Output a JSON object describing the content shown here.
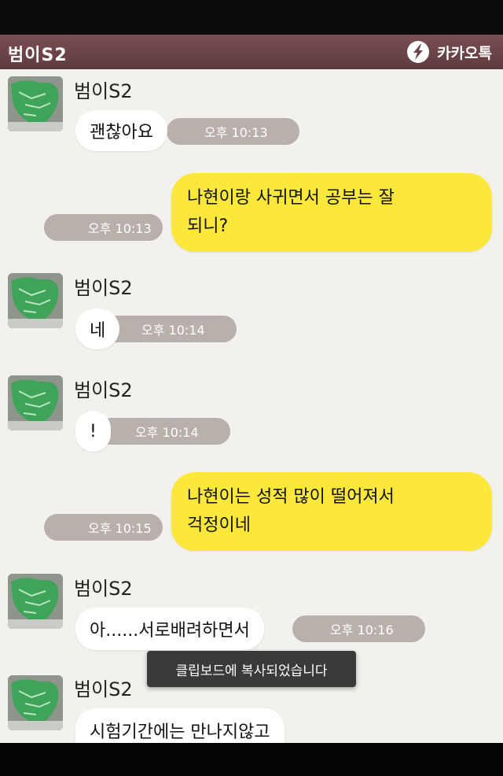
{
  "header": {
    "chat_name": "범이S2",
    "brand": "카카오톡"
  },
  "messages": [
    {
      "sender": "범이S2",
      "text": "괜찮아요",
      "time": "오후 10:13"
    },
    {
      "text": "나현이랑 사귀면서 공부는 잘",
      "text2": "되니?",
      "time": "오후 10:13"
    },
    {
      "sender": "범이S2",
      "text": "네",
      "time": "오후 10:14"
    },
    {
      "sender": "범이S2",
      "text": "!",
      "time": "오후 10:14"
    },
    {
      "text": "나현이는 성적 많이 떨어져서",
      "text2": "걱정이네",
      "time": "오후 10:15"
    },
    {
      "sender": "범이S2",
      "text": "아......서로배려하면서",
      "time": "오후 10:16"
    },
    {
      "sender": "범이S2",
      "text": "시험기간에는 만나지않고"
    }
  ],
  "toast": "클립보드에 복사되었습니다",
  "colors": {
    "title_bar": "#6b4448",
    "background": "#f3f1ec",
    "outgoing_bubble": "#fbe83a",
    "incoming_bubble": "#ffffff",
    "time_pill": "#b8b0aa"
  }
}
